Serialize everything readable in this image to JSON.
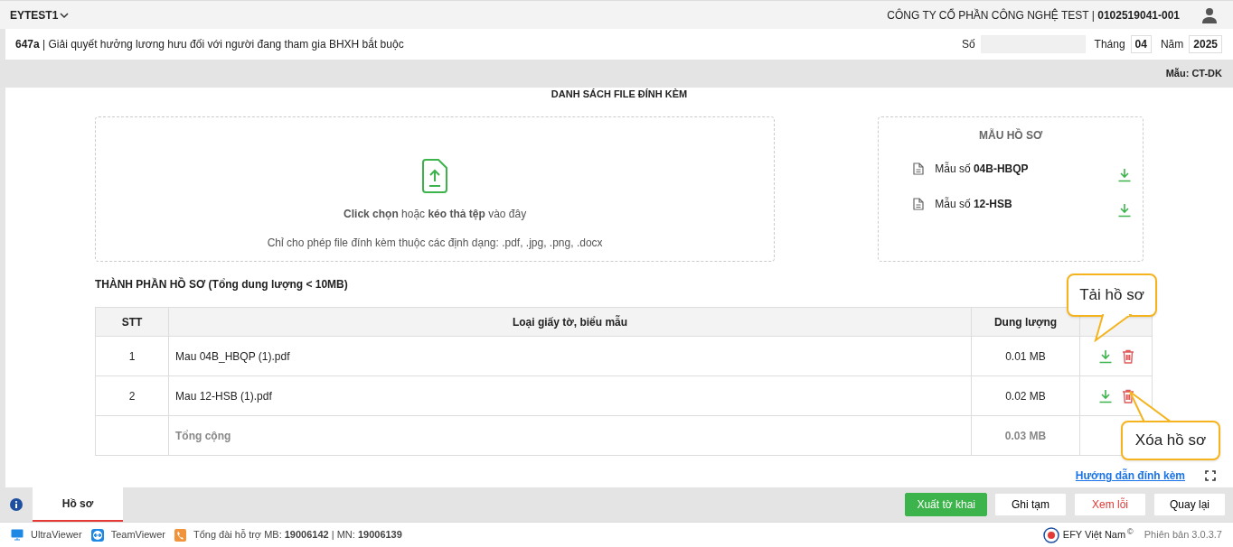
{
  "top_bar": {
    "account": "EYTEST1",
    "company": "CÔNG TY CỔ PHẦN CÔNG NGHỆ TEST | **0102519041-001**"
  },
  "form_header": {
    "title": "**647a** | Giải quyết hưởng lương hưu đối với người đang tham gia BHXH bắt buộc",
    "so_label": "Số",
    "thang_label": "Tháng",
    "thang": "04",
    "nam_label": "Năm",
    "nam": "2025",
    "mau": "Mẫu: CT-DK"
  },
  "section_title": "DANH SÁCH FILE ĐÍNH KÈM",
  "upload": {
    "instruction": "**Click chọn** hoặc **kéo thả tệp** vào đây",
    "hint": "Chỉ cho phép file đính kèm thuộc các định dạng: .pdf, .jpg, .png, .docx"
  },
  "templates": {
    "title": "MẪU HỒ SƠ",
    "items": [
      {
        "label": "Mẫu số **04B-HBQP**"
      },
      {
        "label": "Mẫu số **12-HSB**"
      }
    ]
  },
  "table": {
    "title": "THÀNH PHẦN HỒ SƠ (Tổng dung lượng < 10MB)",
    "columns": [
      "STT",
      "Loại giấy tờ, biểu mẫu",
      "Dung lượng"
    ],
    "rows": [
      {
        "stt": "1",
        "name": "Mau 04B_HBQP (1).pdf",
        "size": "0.01 MB"
      },
      {
        "stt": "2",
        "name": "Mau 12-HSB (1).pdf",
        "size": "0.02 MB"
      }
    ],
    "total_label": "Tổng cộng",
    "total": "0.03 MB"
  },
  "callouts": [
    {
      "kind": "download",
      "text": "Tải hồ sơ"
    },
    {
      "kind": "delete",
      "text": "Xóa hồ sơ"
    }
  ],
  "help_link": "Hướng dẫn đính kèm",
  "tabs": [
    {
      "label": "Hồ sơ",
      "selected": true
    }
  ],
  "buttons": [
    {
      "label": "Xuất tờ khai",
      "kind": "primary"
    },
    {
      "label": "Ghi tạm",
      "kind": "default"
    },
    {
      "label": "Xem lỗi",
      "kind": "danger"
    },
    {
      "label": "Quay lại",
      "kind": "default"
    }
  ],
  "footer": {
    "links": [
      {
        "label": "UltraViewer",
        "kind": "ultraviewer"
      },
      {
        "label": "TeamViewer",
        "kind": "teamviewer"
      },
      {
        "label": "Tổng đài hỗ trợ MB: **19006142** | MN: **19006139**",
        "kind": "phone"
      }
    ],
    "brand": "EFY Việt Nam",
    "copyright": "©",
    "version": "Phiên bản 3.0.3.7"
  }
}
